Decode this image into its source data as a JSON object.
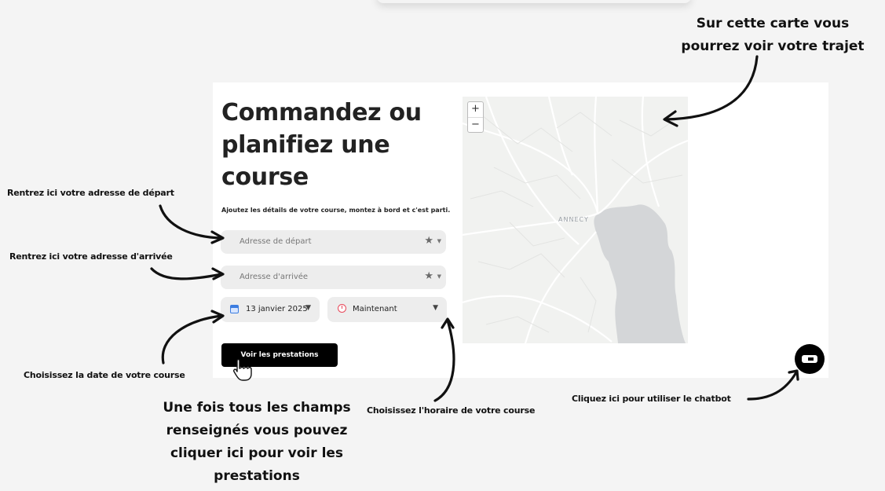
{
  "card": {
    "title": "Commandez ou planifiez une course",
    "subtitle": "Ajoutez les détails de votre course, montez à bord et c'est parti.",
    "pickup": {
      "placeholder": "Adresse de départ"
    },
    "dropoff": {
      "placeholder": "Adresse d'arrivée"
    },
    "date_value": "13 janvier 2025",
    "time_value": "Maintenant",
    "cta_label": "Voir les prestations"
  },
  "map": {
    "zoom_in": "+",
    "zoom_out": "−",
    "city_label": "ANNECY"
  },
  "annotations": {
    "map_hint": "Sur cette carte vous pourrez voir votre trajet",
    "pickup_hint": "Rentrez ici votre adresse de départ",
    "dropoff_hint": "Rentrez ici votre adresse d'arrivée",
    "date_hint": "Choisissez la date de votre course",
    "time_hint": "Choisissez l'horaire de votre course",
    "cta_hint": "Une fois tous les champs renseignés vous pouvez cliquer ici pour voir les prestations",
    "chatbot_hint": "Cliquez ici pour utiliser le chatbot"
  },
  "icons": [
    "star-icon",
    "chevron-down-icon",
    "calendar-icon",
    "alarm-clock-icon",
    "hand-pointer-icon",
    "chatbot-icon"
  ],
  "colors": {
    "cta_bg": "#000000",
    "field_bg": "#ededed",
    "water": "#d4d6d8"
  }
}
